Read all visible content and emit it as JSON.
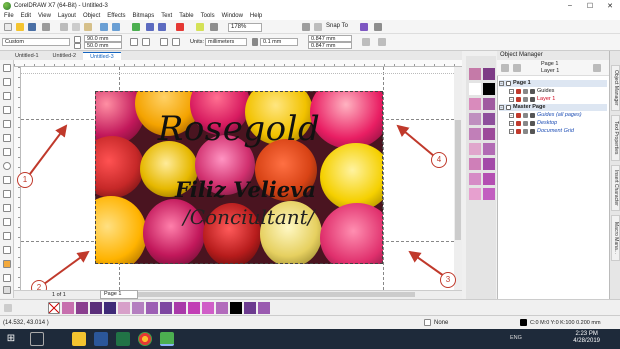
{
  "window": {
    "title": "CorelDRAW X7 (64-Bit) - Untitled-3",
    "min": "–",
    "max": "☐",
    "close": "✕"
  },
  "menu": [
    "File",
    "Edit",
    "View",
    "Layout",
    "Object",
    "Effects",
    "Bitmaps",
    "Text",
    "Table",
    "Tools",
    "Window",
    "Help"
  ],
  "toolbar": {
    "zoom": "178%",
    "snap_to": "Snap To"
  },
  "propbar": {
    "page_size": "Custom",
    "width": "90.0 mm",
    "height": "50.0 mm",
    "units_label": "Units:",
    "units": "millimeters",
    "nudge": "0.1 mm",
    "dup_x": "0.847 mm",
    "dup_y": "0.847 mm"
  },
  "doc_tabs": [
    "Untitled-1",
    "Untitled-2",
    "Untitled-3"
  ],
  "card": {
    "title": "Rosegold",
    "name": "Filiz Velieva",
    "role": "/Conciultant/"
  },
  "markers": [
    "1",
    "2",
    "4",
    "3"
  ],
  "pager": {
    "count": "1 of 1",
    "page_tab": "Page 1"
  },
  "object_manager": {
    "title": "Object Manager",
    "page_label": "Page 1",
    "layer_label": "Layer 1",
    "rows": [
      {
        "label": "Page 1",
        "indent": 0,
        "bold": true
      },
      {
        "label": "Guides",
        "indent": 1
      },
      {
        "label": "Layer 1",
        "indent": 1,
        "color": "#d0021b"
      },
      {
        "label": "Master Page",
        "indent": 0,
        "bold": true
      },
      {
        "label": "Guides (all pages)",
        "indent": 1,
        "color": "#1f4fb5"
      },
      {
        "label": "Desktop",
        "indent": 1,
        "color": "#1f4fb5"
      },
      {
        "label": "Document Grid",
        "indent": 1,
        "color": "#1f4fb5"
      }
    ]
  },
  "docker_tabs": [
    "Object Manager",
    "Text Properties",
    "Insert Character",
    "Macro Mana..."
  ],
  "palette_right": [
    "#c57aa8",
    "#7d3b86",
    "#ffffff",
    "#000000",
    "#d98bbc",
    "#a05ba0",
    "#bf8fbf",
    "#8e4f9c",
    "#c17fb8",
    "#9c4a9a",
    "#e0a6cc",
    "#b26bb4",
    "#cf7fb8",
    "#a34aa8",
    "#d68cc6",
    "#b44fb2",
    "#e7a0cf",
    "#c25ec0"
  ],
  "palette_bottom": [
    "#c76fae",
    "#8a3f8f",
    "#5a2e7a",
    "#3f2a78",
    "#d7a0c9",
    "#b47fc0",
    "#9c5fb4",
    "#7d46a1",
    "#a93aa9",
    "#c23fb5",
    "#d05ec8",
    "#b26bbc",
    "#000000",
    "#6c3b8f",
    "#9a5ab0"
  ],
  "status": {
    "coords": "(14.532, 43.014 )",
    "fill_none": "None",
    "outline": "C:0 M:0 Y:0 K:100  0.200 mm"
  },
  "taskbar": {
    "time": "2:23 PM",
    "date": "4/28/2019",
    "lang": "ENG"
  },
  "colors": {
    "marker": "#c0392b",
    "selected_tab": "#1565c0"
  }
}
